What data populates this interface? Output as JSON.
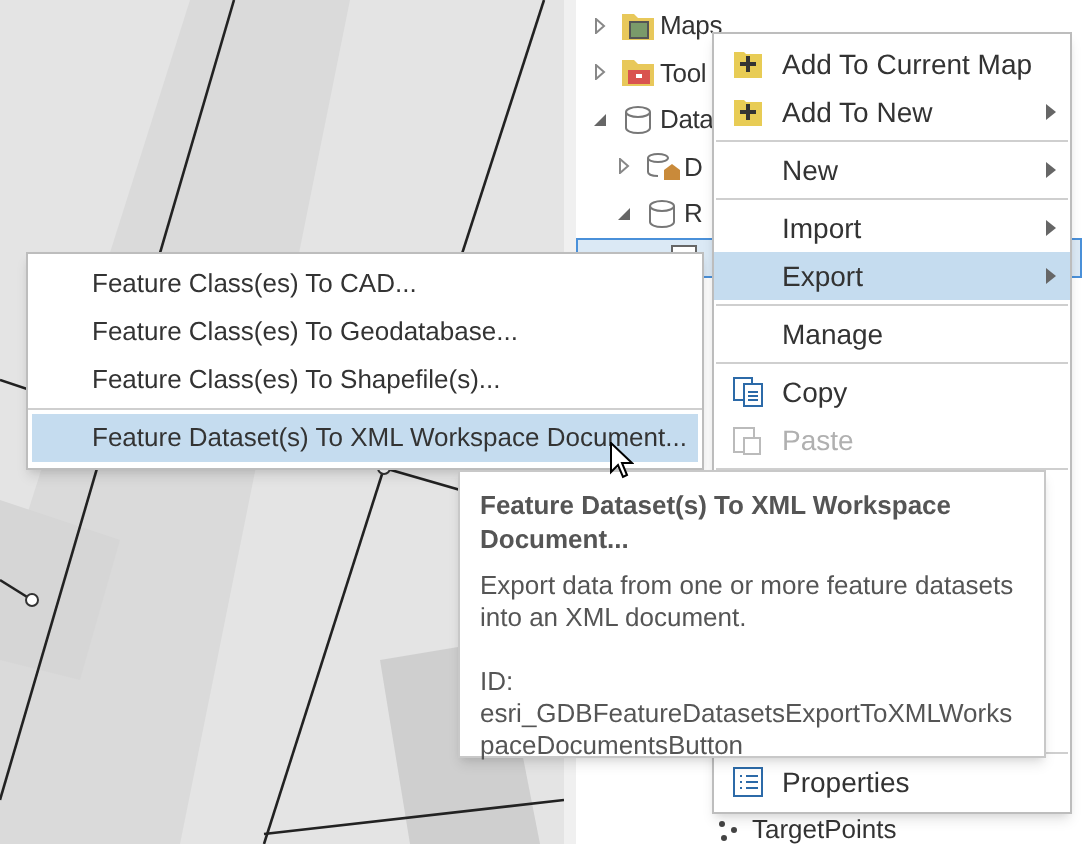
{
  "tree": {
    "items": [
      {
        "label": "Maps",
        "kind": "map",
        "expanded": false
      },
      {
        "label": "Tool",
        "kind": "toolbox",
        "expanded": false
      },
      {
        "label": "Data",
        "kind": "database",
        "expanded": true,
        "children": [
          {
            "label": "D",
            "kind": "home-database",
            "expanded": false
          },
          {
            "label": "R",
            "kind": "database",
            "expanded": true,
            "children": [
              {
                "kind": "dataset",
                "selected": true
              }
            ]
          }
        ]
      }
    ],
    "bottom_item": {
      "label": "TargetPoints"
    }
  },
  "context_menu": {
    "groups": [
      [
        {
          "label": "Add To Current Map",
          "kind": "add",
          "submenu": false,
          "selected": false,
          "disabled": false
        },
        {
          "label": "Add To New",
          "kind": "add",
          "submenu": true,
          "selected": false,
          "disabled": false
        }
      ],
      [
        {
          "label": "New",
          "kind": "plain",
          "submenu": true,
          "selected": false,
          "disabled": false
        }
      ],
      [
        {
          "label": "Import",
          "kind": "plain",
          "submenu": true,
          "selected": false,
          "disabled": false
        },
        {
          "label": "Export",
          "kind": "plain",
          "submenu": true,
          "selected": true,
          "disabled": false
        }
      ],
      [
        {
          "label": "Manage",
          "kind": "plain",
          "submenu": false,
          "selected": false,
          "disabled": false
        }
      ],
      [
        {
          "label": "Copy",
          "kind": "copy",
          "submenu": false,
          "selected": false,
          "disabled": false
        },
        {
          "label": "Paste",
          "kind": "paste",
          "submenu": false,
          "selected": false,
          "disabled": true
        }
      ],
      [
        {
          "label": "Properties",
          "kind": "properties",
          "submenu": false,
          "selected": false,
          "disabled": false
        }
      ]
    ]
  },
  "submenu": {
    "groups": [
      [
        {
          "label": "Feature Class(es) To CAD...",
          "selected": false
        },
        {
          "label": "Feature Class(es) To Geodatabase...",
          "selected": false
        },
        {
          "label": "Feature Class(es) To Shapefile(s)...",
          "selected": false
        }
      ],
      [
        {
          "label": "Feature Dataset(s) To XML Workspace Document...",
          "selected": true
        }
      ]
    ]
  },
  "tooltip": {
    "title": "Feature Dataset(s) To XML Workspace Document...",
    "description": "Export data from one or more feature datasets into an XML document.",
    "id_label": "ID:",
    "id": "esri_GDBFeatureDatasetsExportToXMLWorkspaceDocumentsButton"
  }
}
